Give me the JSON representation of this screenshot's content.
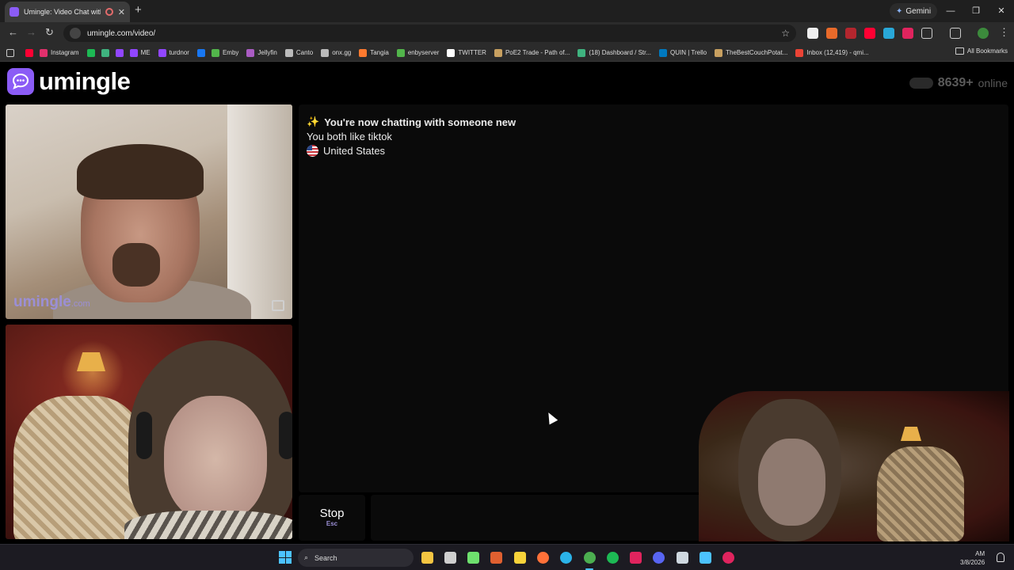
{
  "browser": {
    "tab_title": "Umingle: Video Chat with S",
    "new_tab_icon": "plus-icon",
    "gemini_label": "Gemini",
    "url": "umingle.com/video/",
    "bookmarks": [
      {
        "label": "",
        "color": "#ff0033"
      },
      {
        "label": "Instagram",
        "color": "#e1306c"
      },
      {
        "label": "",
        "color": "#1db954"
      },
      {
        "label": "",
        "color": "#3fb37f"
      },
      {
        "label": "",
        "color": "#9146ff"
      },
      {
        "label": "ME",
        "color": "#9146ff"
      },
      {
        "label": "turdnor",
        "color": "#9146ff"
      },
      {
        "label": "",
        "color": "#1877f2"
      },
      {
        "label": "Emby",
        "color": "#52b54b"
      },
      {
        "label": "Jellyfin",
        "color": "#aa5cc3"
      },
      {
        "label": "Canto",
        "color": "#bbbbbb"
      },
      {
        "label": "onx.gg",
        "color": "#bbbbbb"
      },
      {
        "label": "Tangia",
        "color": "#ff7a2f"
      },
      {
        "label": "enbyserver",
        "color": "#52b54b"
      },
      {
        "label": "TWITTER",
        "color": "#ffffff"
      },
      {
        "label": "PoE2 Trade - Path of...",
        "color": "#c8a060"
      },
      {
        "label": "(18) Dashboard / Str...",
        "color": "#3fb37f"
      },
      {
        "label": "QUIN | Trello",
        "color": "#0079bf"
      },
      {
        "label": "TheBestCouchPotat...",
        "color": "#c8a060"
      },
      {
        "label": "Inbox (12,419) - qmi...",
        "color": "#ea4335"
      }
    ],
    "all_bookmarks_label": "All Bookmarks"
  },
  "site": {
    "logo_text": "umingle",
    "online_count": "8639+",
    "online_label": "online",
    "watermark_main": "umingle",
    "watermark_tld": ".com"
  },
  "chat": {
    "headline_emoji": "✨",
    "headline": "You're now chatting with someone new",
    "interest": "You both like tiktok",
    "country": "United States"
  },
  "controls": {
    "stop_label": "Stop",
    "stop_key": "Esc"
  },
  "taskbar": {
    "search_label": "Search",
    "time": "AM",
    "date": "3/8/2026",
    "icons": [
      {
        "name": "file-explorer-icon",
        "color": "#f4c542"
      },
      {
        "name": "clock-app-icon",
        "color": "#cfcfcf"
      },
      {
        "name": "play-app-icon",
        "color": "#6ee06e"
      },
      {
        "name": "bug-app-icon",
        "color": "#e06030"
      },
      {
        "name": "sticky-notes-icon",
        "color": "#f7d33a"
      },
      {
        "name": "firefox-icon",
        "color": "#ff7139"
      },
      {
        "name": "edge-icon",
        "color": "#2bb3e8"
      },
      {
        "name": "chrome-icon",
        "color": "#4caf50"
      },
      {
        "name": "spotify-icon",
        "color": "#1db954"
      },
      {
        "name": "record-app-icon",
        "color": "#e0245e"
      },
      {
        "name": "discord-icon",
        "color": "#5865f2"
      },
      {
        "name": "steam-icon",
        "color": "#cfd8e0"
      },
      {
        "name": "notepad-icon",
        "color": "#4cc2ff"
      },
      {
        "name": "obs-icon",
        "color": "#e0245e"
      }
    ]
  }
}
